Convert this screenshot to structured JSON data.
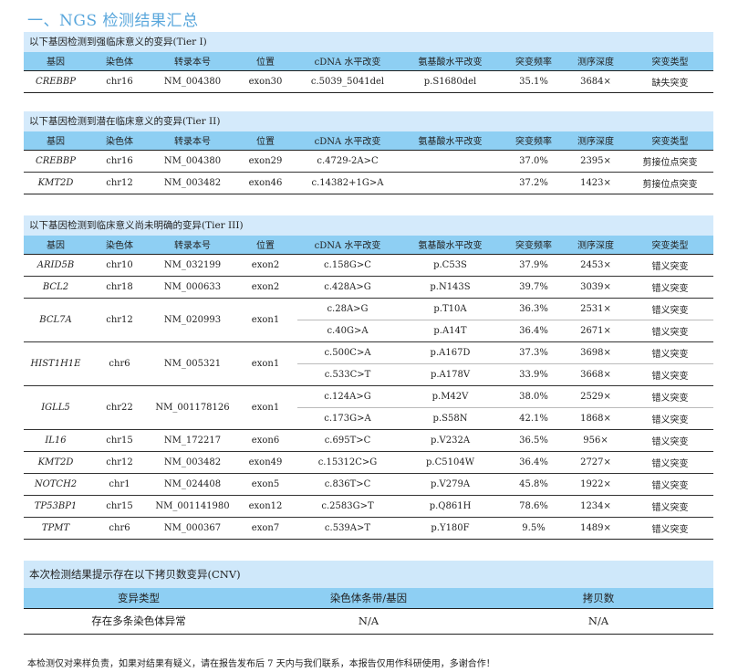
{
  "page_title": "一、NGS 检测结果汇总",
  "columns": [
    "基因",
    "染色体",
    "转录本号",
    "位置",
    "cDNA 水平改变",
    "氨基酸水平改变",
    "突变频率",
    "测序深度",
    "突变类型"
  ],
  "tier1": {
    "title": "以下基因检测到强临床意义的变异(Tier I)",
    "rows": [
      {
        "gene": "CREBBP",
        "chr": "chr16",
        "transcript": "NM_004380",
        "position": "exon30",
        "cdna": "c.5039_5041del",
        "aa": "p.S1680del",
        "freq": "35.1%",
        "depth": "3684×",
        "type": "缺失突变"
      }
    ]
  },
  "tier2": {
    "title": "以下基因检测到潜在临床意义的变异(Tier II)",
    "rows": [
      {
        "gene": "CREBBP",
        "chr": "chr16",
        "transcript": "NM_004380",
        "position": "exon29",
        "cdna": "c.4729-2A>C",
        "aa": "",
        "freq": "37.0%",
        "depth": "2395×",
        "type": "剪接位点突变"
      },
      {
        "gene": "KMT2D",
        "chr": "chr12",
        "transcript": "NM_003482",
        "position": "exon46",
        "cdna": "c.14382+1G>A",
        "aa": "",
        "freq": "37.2%",
        "depth": "1423×",
        "type": "剪接位点突变"
      }
    ]
  },
  "tier3": {
    "title": "以下基因检测到临床意义尚未明确的变异(Tier III)",
    "groups": [
      {
        "gene": "ARID5B",
        "chr": "chr10",
        "transcript": "NM_032199",
        "position": "exon2",
        "variants": [
          {
            "cdna": "c.158G>C",
            "aa": "p.C53S",
            "freq": "37.9%",
            "depth": "2453×",
            "type": "错义突变"
          }
        ]
      },
      {
        "gene": "BCL2",
        "chr": "chr18",
        "transcript": "NM_000633",
        "position": "exon2",
        "variants": [
          {
            "cdna": "c.428A>G",
            "aa": "p.N143S",
            "freq": "39.7%",
            "depth": "3039×",
            "type": "错义突变"
          }
        ]
      },
      {
        "gene": "BCL7A",
        "chr": "chr12",
        "transcript": "NM_020993",
        "position": "exon1",
        "variants": [
          {
            "cdna": "c.28A>G",
            "aa": "p.T10A",
            "freq": "36.3%",
            "depth": "2531×",
            "type": "错义突变"
          },
          {
            "cdna": "c.40G>A",
            "aa": "p.A14T",
            "freq": "36.4%",
            "depth": "2671×",
            "type": "错义突变"
          }
        ]
      },
      {
        "gene": "HIST1H1E",
        "chr": "chr6",
        "transcript": "NM_005321",
        "position": "exon1",
        "variants": [
          {
            "cdna": "c.500C>A",
            "aa": "p.A167D",
            "freq": "37.3%",
            "depth": "3698×",
            "type": "错义突变"
          },
          {
            "cdna": "c.533C>T",
            "aa": "p.A178V",
            "freq": "33.9%",
            "depth": "3668×",
            "type": "错义突变"
          }
        ]
      },
      {
        "gene": "IGLL5",
        "chr": "chr22",
        "transcript": "NM_001178126",
        "position": "exon1",
        "variants": [
          {
            "cdna": "c.124A>G",
            "aa": "p.M42V",
            "freq": "38.0%",
            "depth": "2529×",
            "type": "错义突变"
          },
          {
            "cdna": "c.173G>A",
            "aa": "p.S58N",
            "freq": "42.1%",
            "depth": "1868×",
            "type": "错义突变"
          }
        ]
      },
      {
        "gene": "IL16",
        "chr": "chr15",
        "transcript": "NM_172217",
        "position": "exon6",
        "variants": [
          {
            "cdna": "c.695T>C",
            "aa": "p.V232A",
            "freq": "36.5%",
            "depth": "956×",
            "type": "错义突变"
          }
        ]
      },
      {
        "gene": "KMT2D",
        "chr": "chr12",
        "transcript": "NM_003482",
        "position": "exon49",
        "variants": [
          {
            "cdna": "c.15312C>G",
            "aa": "p.C5104W",
            "freq": "36.4%",
            "depth": "2727×",
            "type": "错义突变"
          }
        ]
      },
      {
        "gene": "NOTCH2",
        "chr": "chr1",
        "transcript": "NM_024408",
        "position": "exon5",
        "variants": [
          {
            "cdna": "c.836T>C",
            "aa": "p.V279A",
            "freq": "45.8%",
            "depth": "1922×",
            "type": "错义突变"
          }
        ]
      },
      {
        "gene": "TP53BP1",
        "chr": "chr15",
        "transcript": "NM_001141980",
        "position": "exon12",
        "variants": [
          {
            "cdna": "c.2583G>T",
            "aa": "p.Q861H",
            "freq": "78.6%",
            "depth": "1234×",
            "type": "错义突变"
          }
        ]
      },
      {
        "gene": "TPMT",
        "chr": "chr6",
        "transcript": "NM_000367",
        "position": "exon7",
        "variants": [
          {
            "cdna": "c.539A>T",
            "aa": "p.Y180F",
            "freq": "9.5%",
            "depth": "1489×",
            "type": "错义突变"
          }
        ]
      }
    ]
  },
  "cnv": {
    "title": "本次检测结果提示存在以下拷贝数变异(CNV)",
    "columns": [
      "变异类型",
      "染色体条带/基因",
      "拷贝数"
    ],
    "rows": [
      {
        "type": "存在多条染色体异常",
        "band": "N/A",
        "copies": "N/A"
      }
    ]
  },
  "footer": "本检测仅对来样负责，如果对结果有疑义，请在报告发布后 7 天内与我们联系，本报告仅用作科研使用，多谢合作！",
  "colors": {
    "title": "#5aa7dc",
    "header_bg": "#8ecff3",
    "banner_bg": "#d4eafb"
  }
}
